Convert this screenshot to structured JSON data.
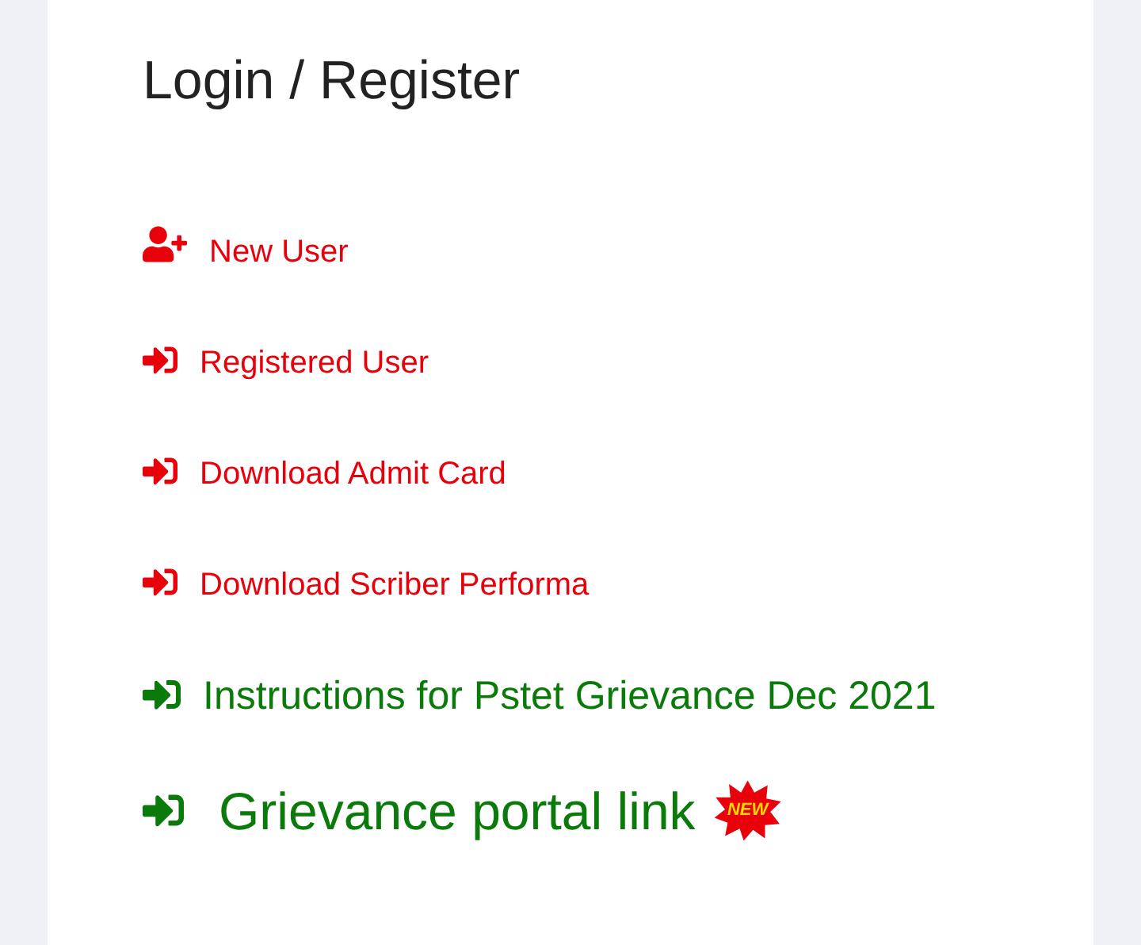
{
  "title": "Login / Register",
  "links": [
    {
      "kind": "add-user",
      "label": "New User",
      "color": "#e8000b"
    },
    {
      "kind": "sign-in",
      "label": "Registered User",
      "color": "#e8000b"
    },
    {
      "kind": "sign-in",
      "label": "Download Admit Card",
      "color": "#e8000b"
    },
    {
      "kind": "sign-in",
      "label": "Download Scriber Performa",
      "color": "#e8000b"
    },
    {
      "kind": "sign-in",
      "label": "Instructions for Pstet Grievance Dec 2021",
      "color": "#0a7a0a"
    }
  ],
  "featured_link": {
    "label": "Grievance portal link",
    "color": "#0a7a0a",
    "badge": "NEW"
  }
}
